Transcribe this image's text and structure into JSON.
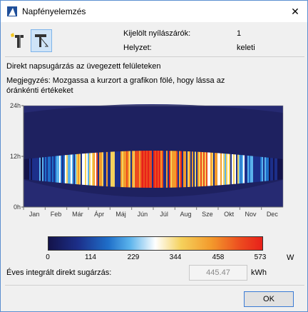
{
  "window": {
    "title": "Napfényelemzés"
  },
  "info": {
    "selected_label": "Kijelölt nyílászárók:",
    "selected_value": "1",
    "orientation_label": "Helyzet:",
    "orientation_value": "keleti"
  },
  "description": "Direkt napsugárzás az üvegezett felületeken",
  "note": "Megjegyzés: Mozgassa a kurzort a grafikon fölé, hogy lássa az óránkénti értékeket",
  "chart_data": {
    "type": "heatmap",
    "x_labels": [
      "Jan",
      "Feb",
      "Már",
      "Ápr",
      "Máj",
      "Jún",
      "Júl",
      "Aug",
      "Sze",
      "Okt",
      "Nov",
      "Dec"
    ],
    "y_labels": [
      "24h",
      "12h",
      "0h"
    ],
    "ylim": [
      0,
      24
    ],
    "color_scale": {
      "min": 0,
      "max": 573,
      "ticks": [
        0,
        114,
        229,
        344,
        458,
        573
      ],
      "unit": "W",
      "colors": [
        "#14134a",
        "#1c2f8a",
        "#1f6fc9",
        "#5ab3ec",
        "#ffffff",
        "#f5d15c",
        "#f39a2c",
        "#ec4a1f",
        "#e8201a"
      ]
    }
  },
  "colorbar_ticks": [
    "0",
    "114",
    "229",
    "344",
    "458",
    "573"
  ],
  "colorbar_unit": "W",
  "annual": {
    "label": "Éves integrált direkt sugárzás:",
    "value": "445.47",
    "unit": "kWh"
  },
  "buttons": {
    "ok": "OK",
    "close": "✕"
  }
}
